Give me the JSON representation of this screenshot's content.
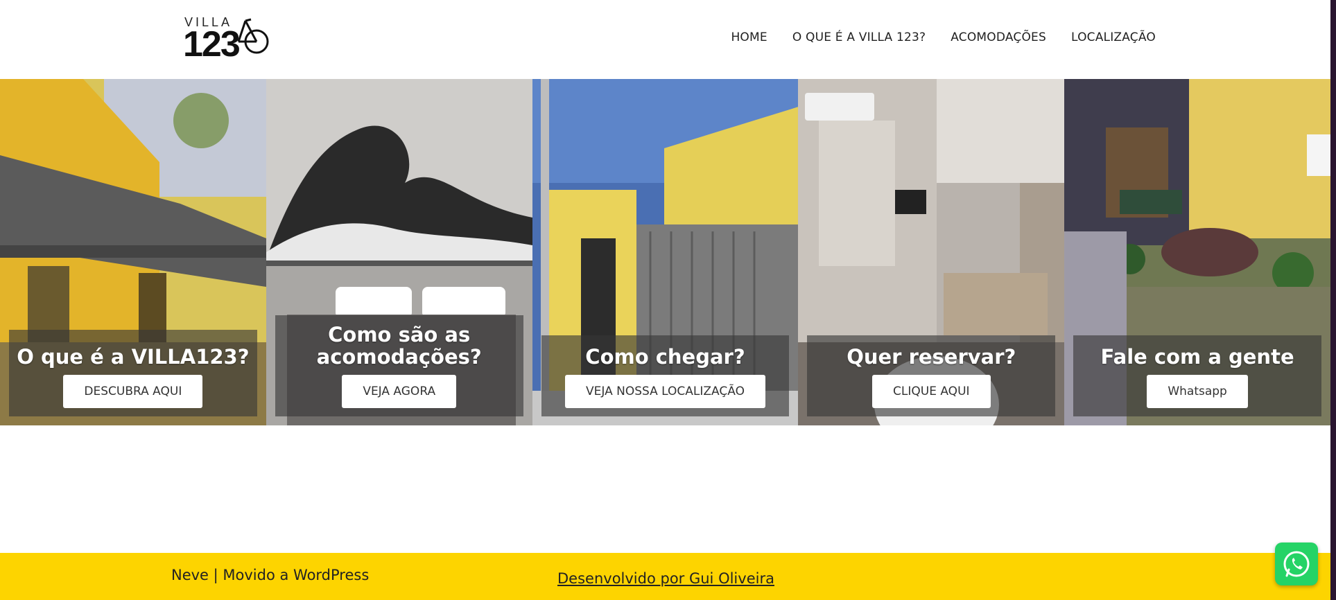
{
  "brand": {
    "logo_top": "VILLA",
    "logo_number": "123"
  },
  "nav": {
    "home": "HOME",
    "about": "O QUE É A VILLA 123?",
    "rooms": "ACOMODAÇÕES",
    "location": "LOCALIZAÇÃO"
  },
  "panels": [
    {
      "title": "O que é a VILLA123?",
      "button": "DESCUBRA AQUI"
    },
    {
      "title": "Como são as acomodações?",
      "button": "VEJA AGORA"
    },
    {
      "title": "Como chegar?",
      "button": "VEJA NOSSA LOCALIZAÇÃO"
    },
    {
      "title": "Quer reservar?",
      "button": "CLIQUE AQUI"
    },
    {
      "title": "Fale com a gente",
      "button": "Whatsapp"
    }
  ],
  "footer": {
    "credit": "Neve | Movido a WordPress",
    "developer": "Desenvolvido por Gui Oliveira"
  },
  "colors": {
    "footer_bg": "#fdd400",
    "whatsapp": "#25d366"
  },
  "icons": {
    "logo": "bicycle-icon",
    "chat": "whatsapp-icon"
  }
}
